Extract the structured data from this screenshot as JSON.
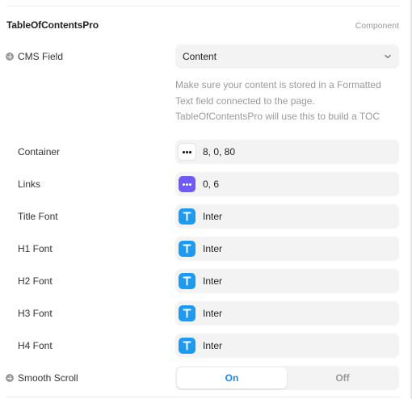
{
  "header": {
    "title": "TableOfContentsPro",
    "badge": "Component"
  },
  "cms_field": {
    "label": "CMS Field",
    "value": "Content",
    "help_lines": [
      "Make sure your content is stored in a Formatted",
      "Text field connected to the page.",
      "TableOfContentsPro will use this to build a TOC"
    ]
  },
  "container": {
    "label": "Container",
    "value": "8, 0, 80",
    "icon": "dots-icon"
  },
  "links": {
    "label": "Links",
    "value": "0, 6",
    "icon": "dots-icon",
    "icon_color": "#6e5af7"
  },
  "fonts": [
    {
      "label": "Title Font",
      "value": "Inter",
      "icon": "text-t-icon"
    },
    {
      "label": "H1 Font",
      "value": "Inter",
      "icon": "text-t-icon"
    },
    {
      "label": "H2 Font",
      "value": "Inter",
      "icon": "text-t-icon"
    },
    {
      "label": "H3 Font",
      "value": "Inter",
      "icon": "text-t-icon"
    },
    {
      "label": "H4 Font",
      "value": "Inter",
      "icon": "text-t-icon"
    }
  ],
  "smooth_scroll": {
    "label": "Smooth Scroll",
    "on_label": "On",
    "off_label": "Off",
    "selected": "On"
  },
  "colors": {
    "accent_blue": "#1d9bf0",
    "selected_text": "#1d86e6",
    "purple": "#6e5af7"
  }
}
